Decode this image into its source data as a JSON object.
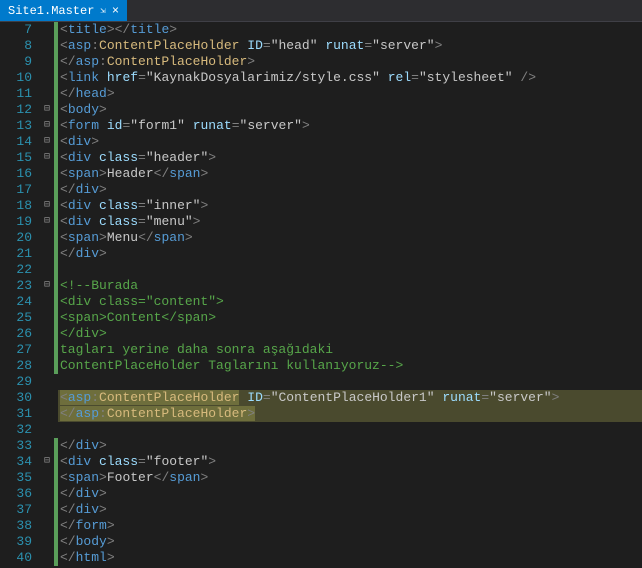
{
  "tab": {
    "title": "Site1.Master",
    "pin_glyph": "⇲",
    "close_glyph": "×"
  },
  "lines": [
    {
      "n": 7,
      "fold": "",
      "chg": true,
      "html": "        <span class='punc'>&lt;</span><span class='tag'>title</span><span class='punc'>&gt;&lt;/</span><span class='tag'>title</span><span class='punc'>&gt;</span>"
    },
    {
      "n": 8,
      "fold": "",
      "chg": true,
      "html": "        <span class='punc'>&lt;</span><span class='tag'>asp</span><span class='punc'>:</span><span class='asp'>ContentPlaceHolder</span> <span class='attr'>ID</span><span class='punc'>=</span><span class='str'>\"head\"</span> <span class='attr'>runat</span><span class='punc'>=</span><span class='str'>\"server\"</span><span class='punc'>&gt;</span>"
    },
    {
      "n": 9,
      "fold": "",
      "chg": true,
      "html": "        <span class='punc'>&lt;/</span><span class='tag'>asp</span><span class='punc'>:</span><span class='asp'>ContentPlaceHolder</span><span class='punc'>&gt;</span>"
    },
    {
      "n": 10,
      "fold": "",
      "chg": true,
      "html": "        <span class='punc'>&lt;</span><span class='tag'>link</span> <span class='attr'>href</span><span class='punc'>=</span><span class='str'>\"KaynakDosyalarimiz/style.css\"</span> <span class='attr'>rel</span><span class='punc'>=</span><span class='str'>\"stylesheet\"</span> <span class='punc'>/&gt;</span>"
    },
    {
      "n": 11,
      "fold": "",
      "chg": true,
      "html": "    <span class='punc'>&lt;/</span><span class='tag'>head</span><span class='punc'>&gt;</span>"
    },
    {
      "n": 12,
      "fold": "⊟",
      "chg": true,
      "html": "    <span class='punc'>&lt;</span><span class='tag'>body</span><span class='punc'>&gt;</span>"
    },
    {
      "n": 13,
      "fold": "⊟",
      "chg": true,
      "html": "        <span class='punc'>&lt;</span><span class='tag'>form</span> <span class='attr'>id</span><span class='punc'>=</span><span class='str'>\"form1\"</span> <span class='attr'>runat</span><span class='punc'>=</span><span class='str'>\"server\"</span><span class='punc'>&gt;</span>"
    },
    {
      "n": 14,
      "fold": "⊟",
      "chg": true,
      "html": "            <span class='punc'>&lt;</span><span class='tag'>div</span><span class='punc'>&gt;</span>"
    },
    {
      "n": 15,
      "fold": "⊟",
      "chg": true,
      "html": "                <span class='punc'>&lt;</span><span class='tag'>div</span> <span class='attr'>class</span><span class='punc'>=</span><span class='str'>\"header\"</span><span class='punc'>&gt;</span>"
    },
    {
      "n": 16,
      "fold": "",
      "chg": true,
      "html": "                    <span class='punc'>&lt;</span><span class='tag'>span</span><span class='punc'>&gt;</span><span class='text'>Header</span><span class='punc'>&lt;/</span><span class='tag'>span</span><span class='punc'>&gt;</span>"
    },
    {
      "n": 17,
      "fold": "",
      "chg": true,
      "html": "                <span class='punc'>&lt;/</span><span class='tag'>div</span><span class='punc'>&gt;</span>"
    },
    {
      "n": 18,
      "fold": "⊟",
      "chg": true,
      "html": "                <span class='punc'>&lt;</span><span class='tag'>div</span> <span class='attr'>class</span><span class='punc'>=</span><span class='str'>\"inner\"</span><span class='punc'>&gt;</span>"
    },
    {
      "n": 19,
      "fold": "⊟",
      "chg": true,
      "html": "                    <span class='punc'>&lt;</span><span class='tag'>div</span> <span class='attr'>class</span><span class='punc'>=</span><span class='str'>\"menu\"</span><span class='punc'>&gt;</span>"
    },
    {
      "n": 20,
      "fold": "",
      "chg": true,
      "html": "                        <span class='punc'>&lt;</span><span class='tag'>span</span><span class='punc'>&gt;</span><span class='text'>Menu</span><span class='punc'>&lt;/</span><span class='tag'>span</span><span class='punc'>&gt;</span>"
    },
    {
      "n": 21,
      "fold": "",
      "chg": true,
      "html": "                    <span class='punc'>&lt;/</span><span class='tag'>div</span><span class='punc'>&gt;</span>"
    },
    {
      "n": 22,
      "fold": "",
      "chg": true,
      "html": ""
    },
    {
      "n": 23,
      "fold": "⊟",
      "chg": true,
      "html": "                    <span class='comment'>&lt;!--Burada</span>"
    },
    {
      "n": 24,
      "fold": "",
      "chg": true,
      "html": "                    <span class='comment'>&lt;div class=\"content\"&gt;</span>"
    },
    {
      "n": 25,
      "fold": "",
      "chg": true,
      "html": "                    <span class='comment'>&lt;span&gt;Content&lt;/span&gt;</span>"
    },
    {
      "n": 26,
      "fold": "",
      "chg": true,
      "html": "                    <span class='comment'>&lt;/div&gt;</span>"
    },
    {
      "n": 27,
      "fold": "",
      "chg": true,
      "html": "                    <span class='comment'>tagları yerine daha sonra aşağıdaki</span>"
    },
    {
      "n": 28,
      "fold": "",
      "chg": true,
      "html": "                    <span class='comment'>ContentPlaceHolder Taglarını kullanıyoruz--&gt;</span>"
    },
    {
      "n": 29,
      "fold": "",
      "chg": false,
      "html": ""
    },
    {
      "n": 30,
      "fold": "",
      "chg": false,
      "hl": true,
      "html": "                    <span class='hl-bright'><span class='punc'>&lt;</span><span class='tag'>asp</span><span class='punc'>:</span><span class='asp'>ContentPlaceHolder</span></span> <span class='attr'>ID</span><span class='punc'>=</span><span class='str'>\"ContentPlaceHolder1\"</span> <span class='attr'>runat</span><span class='punc'>=</span><span class='str'>\"server\"</span><span class='punc'>&gt;</span>"
    },
    {
      "n": 31,
      "fold": "",
      "chg": false,
      "hl": true,
      "html": "                    <span class='hl-bright'><span class='punc'>&lt;/</span><span class='tag'>asp</span><span class='punc'>:</span><span class='asp'>ContentPlaceHolder</span><span class='punc'>&gt;</span></span>"
    },
    {
      "n": 32,
      "fold": "",
      "chg": false,
      "html": ""
    },
    {
      "n": 33,
      "fold": "",
      "chg": true,
      "html": "                <span class='punc'>&lt;/</span><span class='tag'>div</span><span class='punc'>&gt;</span>"
    },
    {
      "n": 34,
      "fold": "⊟",
      "chg": true,
      "html": "                <span class='punc'>&lt;</span><span class='tag'>div</span> <span class='attr'>class</span><span class='punc'>=</span><span class='str'>\"footer\"</span><span class='punc'>&gt;</span>"
    },
    {
      "n": 35,
      "fold": "",
      "chg": true,
      "html": "                    <span class='punc'>&lt;</span><span class='tag'>span</span><span class='punc'>&gt;</span><span class='text'>Footer</span><span class='punc'>&lt;/</span><span class='tag'>span</span><span class='punc'>&gt;</span>"
    },
    {
      "n": 36,
      "fold": "",
      "chg": true,
      "html": "                <span class='punc'>&lt;/</span><span class='tag'>div</span><span class='punc'>&gt;</span>"
    },
    {
      "n": 37,
      "fold": "",
      "chg": true,
      "html": "            <span class='punc'>&lt;/</span><span class='tag'>div</span><span class='punc'>&gt;</span>"
    },
    {
      "n": 38,
      "fold": "",
      "chg": true,
      "html": "        <span class='punc'>&lt;/</span><span class='tag'>form</span><span class='punc'>&gt;</span>"
    },
    {
      "n": 39,
      "fold": "",
      "chg": true,
      "html": "    <span class='punc'>&lt;/</span><span class='tag'>body</span><span class='punc'>&gt;</span>"
    },
    {
      "n": 40,
      "fold": "",
      "chg": true,
      "html": "    <span class='punc'>&lt;/</span><span class='tag'>html</span><span class='punc'>&gt;</span>"
    }
  ]
}
